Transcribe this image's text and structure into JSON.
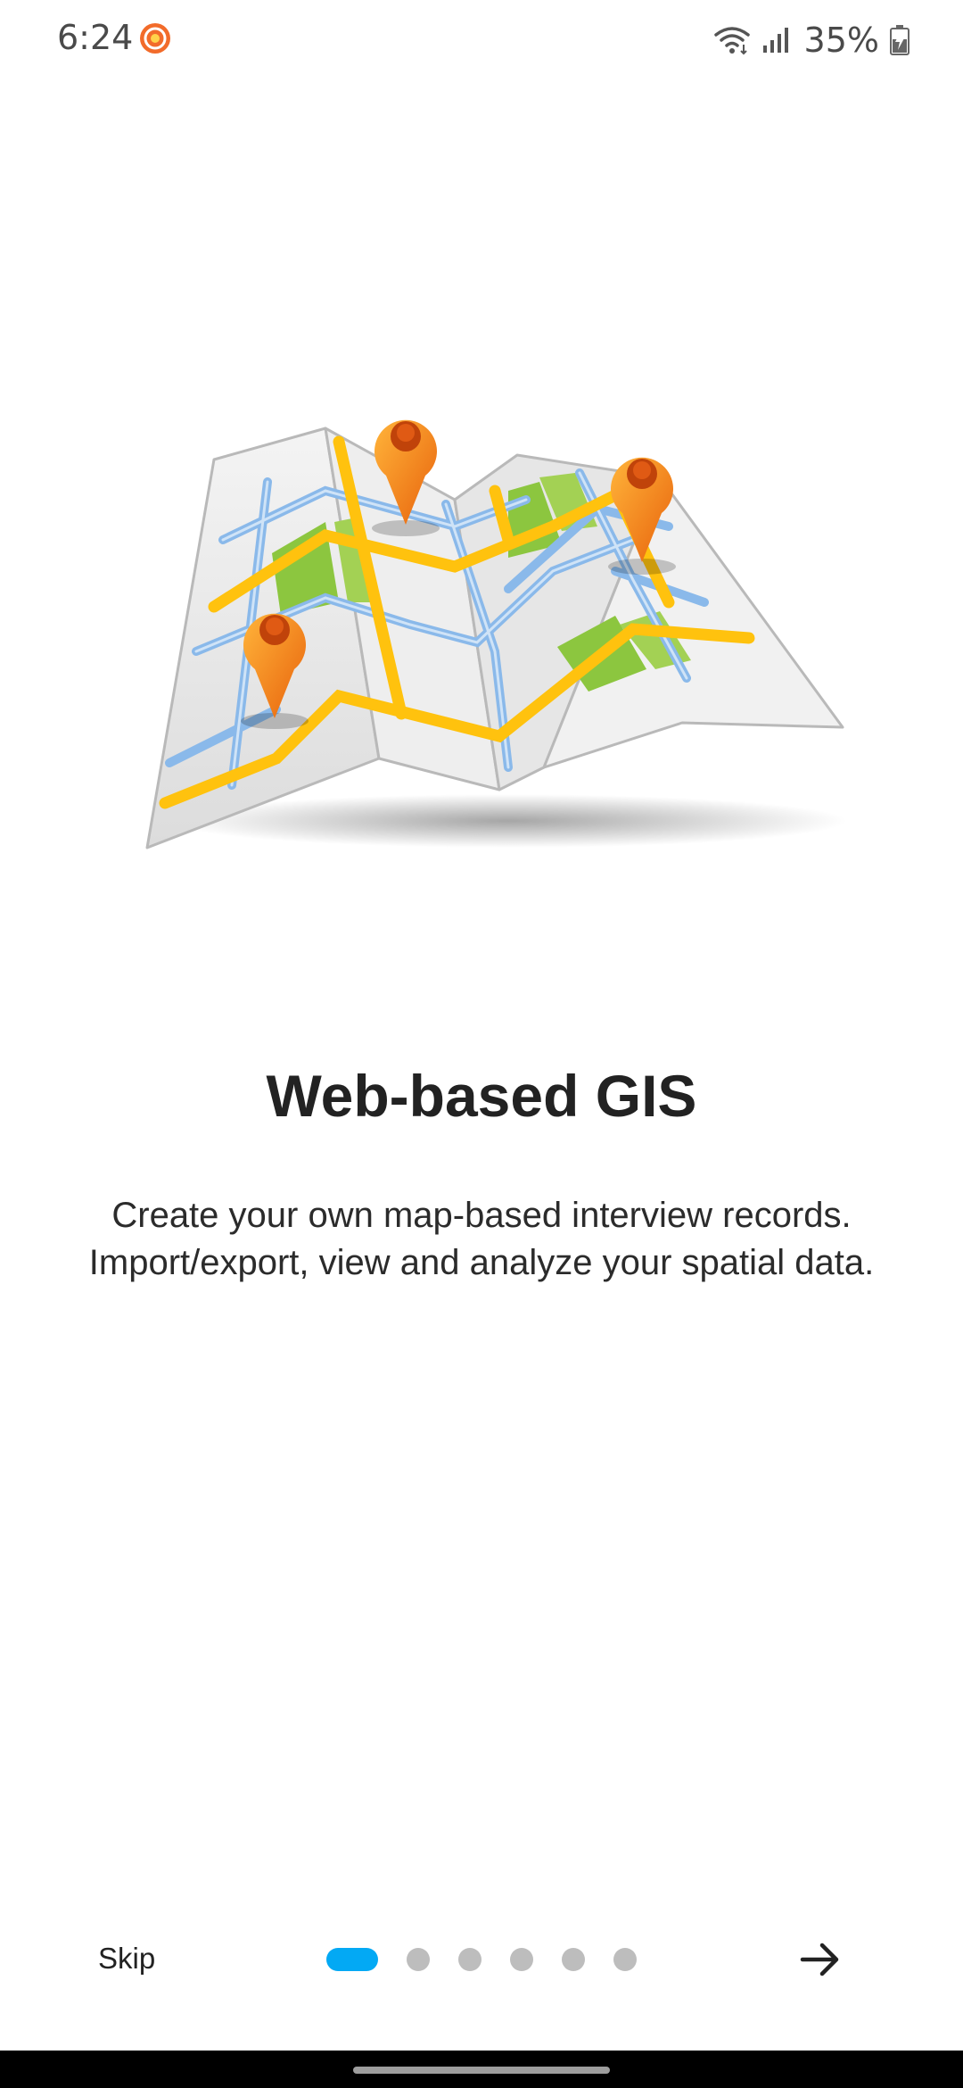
{
  "status_bar": {
    "time": "6:24",
    "battery_percent": "35%",
    "app_icon": "record-app-icon",
    "wifi_icon": "wifi-icon",
    "signal_icon": "signal-icon",
    "battery_icon": "battery-charging-icon"
  },
  "onboarding": {
    "illustration_icon": "folded-map-with-pins-icon",
    "title": "Web-based GIS",
    "description": "Create your own map-based interview records. Import/export, view and analyze your spatial data.",
    "page_count": 6,
    "current_page": 1
  },
  "navigation": {
    "skip_label": "Skip",
    "next_icon": "arrow-right-icon"
  },
  "colors": {
    "accent": "#03a9f4",
    "inactive_dot": "#bdbdbd",
    "pin": "#f7941d",
    "road": "#ffc20e",
    "water_road": "#9cc8f0",
    "park": "#8cc63f"
  }
}
